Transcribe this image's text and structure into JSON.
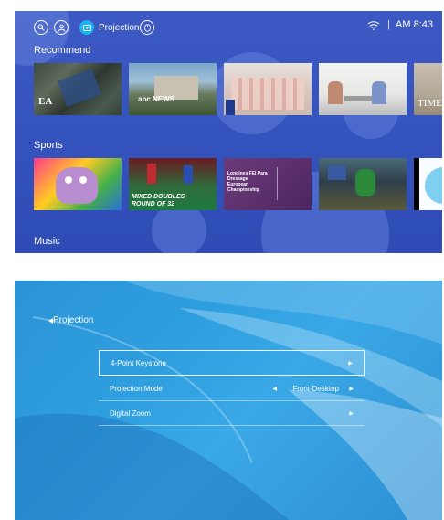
{
  "home": {
    "status_time": "AM 8:43",
    "projection_tab_label": "Projection",
    "sections": {
      "recommend": "Recommend",
      "sports": "Sports",
      "music": "Music"
    },
    "tiles": {
      "recommend": [
        {
          "name": "Drone aerial",
          "caption": "EA"
        },
        {
          "name": "abc News",
          "caption": "abc NEWS"
        },
        {
          "name": "Group photo",
          "caption": ""
        },
        {
          "name": "Interview",
          "caption": ""
        },
        {
          "name": "TIME",
          "caption": "TIME"
        }
      ],
      "sports": [
        {
          "name": "Cartoon",
          "caption": ""
        },
        {
          "name": "Badminton",
          "caption": "MIXED DOUBLES ROUND OF 32"
        },
        {
          "name": "Dressage",
          "caption": "Longines FEI Para Dressage European Championship"
        },
        {
          "name": "Cycling",
          "caption": ""
        },
        {
          "name": "Cartoon2",
          "caption": ""
        }
      ]
    },
    "colors": {
      "accent": "#19b3ef",
      "background": "#3553bd"
    }
  },
  "projection": {
    "back_label": "Projection",
    "menu": [
      {
        "label": "4-Point Keystone",
        "value": ""
      },
      {
        "label": "Projection Mode",
        "value": "Front-Desktop"
      },
      {
        "label": "Digital Zoom",
        "value": ""
      }
    ]
  }
}
